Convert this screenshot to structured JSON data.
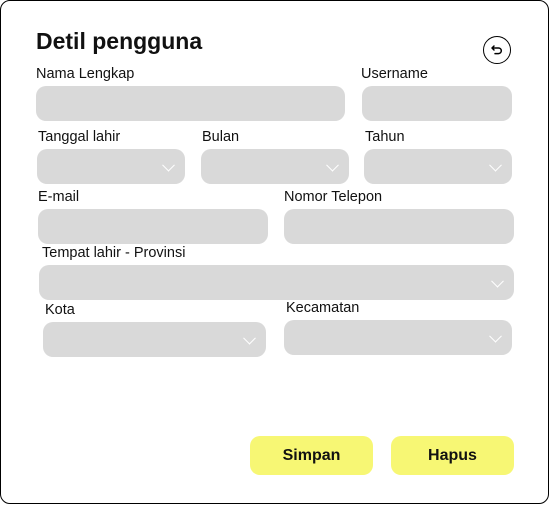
{
  "title": "Detil pengguna",
  "icons": {
    "reset": "undo-icon",
    "dropdown": "chevron-down-icon"
  },
  "fields": {
    "full_name": {
      "label": "Nama Lengkap",
      "value": ""
    },
    "username": {
      "label": "Username",
      "value": ""
    },
    "birth_day": {
      "label": "Tanggal lahir",
      "value": ""
    },
    "birth_month": {
      "label": "Bulan",
      "value": ""
    },
    "birth_year": {
      "label": "Tahun",
      "value": ""
    },
    "email": {
      "label": "E-mail",
      "value": ""
    },
    "phone": {
      "label": "Nomor Telepon",
      "value": ""
    },
    "province": {
      "label": "Tempat lahir - Provinsi",
      "value": ""
    },
    "city": {
      "label": "Kota",
      "value": ""
    },
    "district": {
      "label": "Kecamatan",
      "value": ""
    }
  },
  "buttons": {
    "save": "Simpan",
    "delete": "Hapus"
  },
  "colors": {
    "field_bg": "#d9d9d9",
    "button_bg": "#f7f774"
  }
}
